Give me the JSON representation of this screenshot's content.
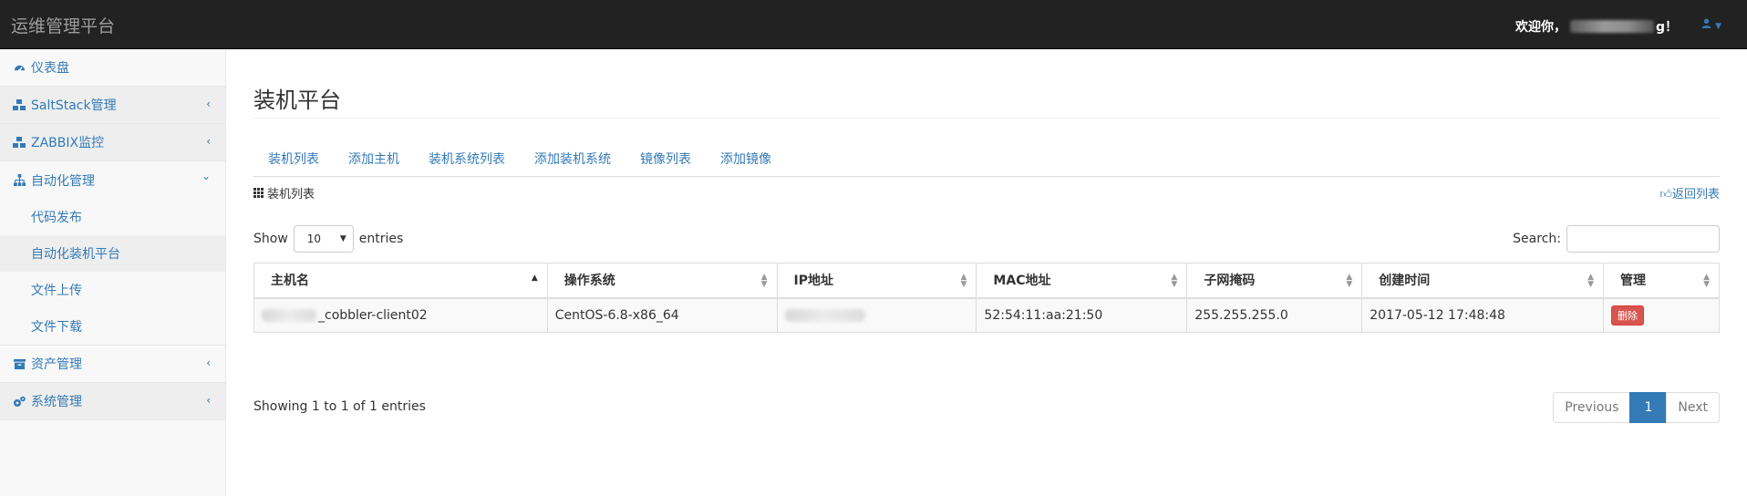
{
  "app": {
    "brand": "运维管理平台",
    "welcome_prefix": "欢迎你，",
    "welcome_suffix": "g！"
  },
  "sidebar": {
    "items": [
      {
        "label": "仪表盘",
        "icon": "dashboard-icon"
      },
      {
        "label": "SaltStack管理",
        "icon": "cubes-icon",
        "arrow": "‹"
      },
      {
        "label": "ZABBIX监控",
        "icon": "cubes-icon",
        "arrow": "‹"
      },
      {
        "label": "自动化管理",
        "icon": "sitemap-icon",
        "arrow": "⌄"
      },
      {
        "label": "资产管理",
        "icon": "archive-icon",
        "arrow": "‹"
      },
      {
        "label": "系统管理",
        "icon": "gears-icon",
        "arrow": "‹"
      }
    ],
    "subitems": [
      "代码发布",
      "自动化装机平台",
      "文件上传",
      "文件下载"
    ]
  },
  "main": {
    "title": "装机平台",
    "tabs": [
      "装机列表",
      "添加主机",
      "装机系统列表",
      "添加装机系统",
      "镜像列表",
      "添加镜像"
    ],
    "list_label": "装机列表",
    "return_label": "返回列表"
  },
  "table_controls": {
    "show_label": "Show",
    "page_size": "10",
    "entries_label": "entries",
    "search_label": "Search:"
  },
  "table": {
    "headers": [
      "主机名",
      "操作系统",
      "IP地址",
      "MAC地址",
      "子网掩码",
      "创建时间",
      "管理"
    ],
    "rows": [
      {
        "hostname": "_cobbler-client02",
        "os": "CentOS-6.8-x86_64",
        "ip": "",
        "mac": "52:54:11:aa:21:50",
        "netmask": "255.255.255.0",
        "created": "2017-05-12 17:48:48",
        "action": "删除"
      }
    ]
  },
  "footer": {
    "info": "Showing 1 to 1 of 1 entries",
    "prev": "Previous",
    "page": "1",
    "next": "Next"
  },
  "colors": {
    "accent": "#337ab7",
    "topbar": "#222222",
    "danger": "#d9534f"
  }
}
